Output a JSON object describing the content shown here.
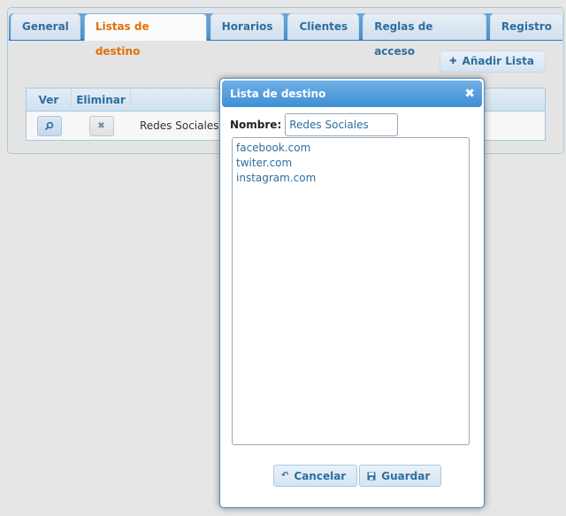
{
  "tabs": [
    {
      "label": "General"
    },
    {
      "label": "Listas de destino"
    },
    {
      "label": "Horarios"
    },
    {
      "label": "Clientes"
    },
    {
      "label": "Reglas de acceso"
    },
    {
      "label": "Registro"
    }
  ],
  "toolbar": {
    "add_label": "Añadir Lista"
  },
  "table": {
    "headers": {
      "ver": "Ver",
      "eliminar": "Eliminar"
    },
    "rows": [
      {
        "name": "Redes Sociales"
      }
    ]
  },
  "dialog": {
    "title": "Lista de destino",
    "name_label": "Nombre:",
    "name_value": "Redes Sociales",
    "list_items": [
      "facebook.com",
      "twiter.com",
      "instagram.com"
    ],
    "cancel_label": "Cancelar",
    "save_label": "Guardar"
  },
  "icons": {
    "add": "plus-icon",
    "view": "magnifier-icon",
    "delete": "close-icon",
    "dialog_close": "close-icon",
    "cancel": "undo-arrow-icon",
    "save": "disk-icon"
  },
  "colors": {
    "active_tab_text": "#e17009",
    "tab_text": "#2e6e9e",
    "title_bar": "#3f8fd6"
  }
}
